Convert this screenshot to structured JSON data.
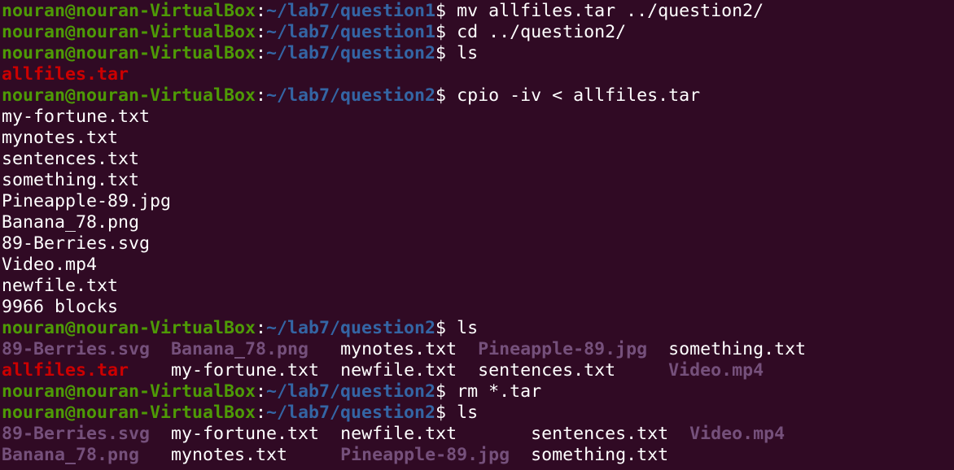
{
  "terminal": {
    "colors": {
      "background": "#300a24",
      "user_host": "#4e9a06",
      "path": "#3465a4",
      "text": "#ffffff",
      "archive": "#cc0000",
      "media": "#75507b"
    },
    "prompt_user": "nouran@nouran-VirtualBox",
    "lines": [
      [
        {
          "t": "nouran@nouran-VirtualBox",
          "c": "user"
        },
        {
          "t": ":",
          "c": "colon"
        },
        {
          "t": "~/lab7/question1",
          "c": "path"
        },
        {
          "t": "$ ",
          "c": "dollar"
        },
        {
          "t": "mv allfiles.tar ../question2/",
          "c": "cmd"
        }
      ],
      [
        {
          "t": "nouran@nouran-VirtualBox",
          "c": "user"
        },
        {
          "t": ":",
          "c": "colon"
        },
        {
          "t": "~/lab7/question1",
          "c": "path"
        },
        {
          "t": "$ ",
          "c": "dollar"
        },
        {
          "t": "cd ../question2/",
          "c": "cmd"
        }
      ],
      [
        {
          "t": "nouran@nouran-VirtualBox",
          "c": "user"
        },
        {
          "t": ":",
          "c": "colon"
        },
        {
          "t": "~/lab7/question2",
          "c": "path"
        },
        {
          "t": "$ ",
          "c": "dollar"
        },
        {
          "t": "ls",
          "c": "cmd"
        }
      ],
      [
        {
          "t": "allfiles.tar",
          "c": "red"
        }
      ],
      [
        {
          "t": "nouran@nouran-VirtualBox",
          "c": "user"
        },
        {
          "t": ":",
          "c": "colon"
        },
        {
          "t": "~/lab7/question2",
          "c": "path"
        },
        {
          "t": "$ ",
          "c": "dollar"
        },
        {
          "t": "cpio -iv < allfiles.tar",
          "c": "cmd"
        }
      ],
      [
        {
          "t": "my-fortune.txt",
          "c": "plain"
        }
      ],
      [
        {
          "t": "mynotes.txt",
          "c": "plain"
        }
      ],
      [
        {
          "t": "sentences.txt",
          "c": "plain"
        }
      ],
      [
        {
          "t": "something.txt",
          "c": "plain"
        }
      ],
      [
        {
          "t": "Pineapple-89.jpg",
          "c": "plain"
        }
      ],
      [
        {
          "t": "Banana_78.png",
          "c": "plain"
        }
      ],
      [
        {
          "t": "89-Berries.svg",
          "c": "plain"
        }
      ],
      [
        {
          "t": "Video.mp4",
          "c": "plain"
        }
      ],
      [
        {
          "t": "newfile.txt",
          "c": "plain"
        }
      ],
      [
        {
          "t": "9966 blocks",
          "c": "plain"
        }
      ],
      [
        {
          "t": "nouran@nouran-VirtualBox",
          "c": "user"
        },
        {
          "t": ":",
          "c": "colon"
        },
        {
          "t": "~/lab7/question2",
          "c": "path"
        },
        {
          "t": "$ ",
          "c": "dollar"
        },
        {
          "t": "ls",
          "c": "cmd"
        }
      ],
      [
        {
          "t": "89-Berries.svg",
          "c": "media"
        },
        {
          "t": "  ",
          "c": "plain"
        },
        {
          "t": "Banana_78.png",
          "c": "media"
        },
        {
          "t": "   ",
          "c": "plain"
        },
        {
          "t": "mynotes.txt",
          "c": "plain"
        },
        {
          "t": "  ",
          "c": "plain"
        },
        {
          "t": "Pineapple-89.jpg",
          "c": "media"
        },
        {
          "t": "  ",
          "c": "plain"
        },
        {
          "t": "something.txt",
          "c": "plain"
        }
      ],
      [
        {
          "t": "allfiles.tar",
          "c": "red"
        },
        {
          "t": "    ",
          "c": "plain"
        },
        {
          "t": "my-fortune.txt",
          "c": "plain"
        },
        {
          "t": "  ",
          "c": "plain"
        },
        {
          "t": "newfile.txt",
          "c": "plain"
        },
        {
          "t": "  ",
          "c": "plain"
        },
        {
          "t": "sentences.txt",
          "c": "plain"
        },
        {
          "t": "     ",
          "c": "plain"
        },
        {
          "t": "Video.mp4",
          "c": "media"
        }
      ],
      [
        {
          "t": "nouran@nouran-VirtualBox",
          "c": "user"
        },
        {
          "t": ":",
          "c": "colon"
        },
        {
          "t": "~/lab7/question2",
          "c": "path"
        },
        {
          "t": "$ ",
          "c": "dollar"
        },
        {
          "t": "rm *.tar",
          "c": "cmd"
        }
      ],
      [
        {
          "t": "nouran@nouran-VirtualBox",
          "c": "user"
        },
        {
          "t": ":",
          "c": "colon"
        },
        {
          "t": "~/lab7/question2",
          "c": "path"
        },
        {
          "t": "$ ",
          "c": "dollar"
        },
        {
          "t": "ls",
          "c": "cmd"
        }
      ],
      [
        {
          "t": "89-Berries.svg",
          "c": "media"
        },
        {
          "t": "  ",
          "c": "plain"
        },
        {
          "t": "my-fortune.txt",
          "c": "plain"
        },
        {
          "t": "  ",
          "c": "plain"
        },
        {
          "t": "newfile.txt",
          "c": "plain"
        },
        {
          "t": "       ",
          "c": "plain"
        },
        {
          "t": "sentences.txt",
          "c": "plain"
        },
        {
          "t": "  ",
          "c": "plain"
        },
        {
          "t": "Video.mp4",
          "c": "media"
        }
      ],
      [
        {
          "t": "Banana_78.png",
          "c": "media"
        },
        {
          "t": "   ",
          "c": "plain"
        },
        {
          "t": "mynotes.txt",
          "c": "plain"
        },
        {
          "t": "     ",
          "c": "plain"
        },
        {
          "t": "Pineapple-89.jpg",
          "c": "media"
        },
        {
          "t": "  ",
          "c": "plain"
        },
        {
          "t": "something.txt",
          "c": "plain"
        }
      ]
    ]
  }
}
